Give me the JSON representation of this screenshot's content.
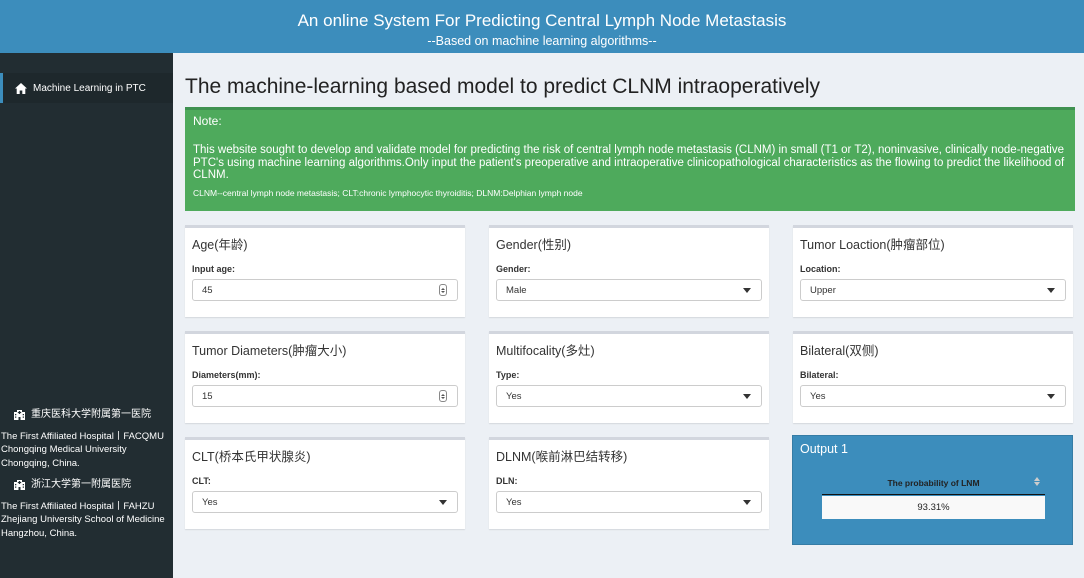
{
  "header": {
    "title": "An online System For Predicting Central Lymph Node Metastasis",
    "subtitle": "--Based on machine learning algorithms--"
  },
  "sidebar": {
    "menu_item": {
      "label": "Machine Learning in PTC",
      "icon": "home-icon"
    },
    "hospitals": [
      {
        "cn_name": "重庆医科大学附属第一医院",
        "icon": "hospital-icon",
        "lines": [
          "The First Affiliated Hospital丨FACQMU",
          "Chongqing Medical University",
          "Chongqing, China."
        ]
      },
      {
        "cn_name": "浙江大学第一附属医院",
        "icon": "hospital-icon",
        "lines": [
          "The First Affiliated Hospital丨FAHZU",
          "Zhejiang University School of Medicine",
          "Hangzhou, China."
        ]
      }
    ]
  },
  "main": {
    "title": "The machine-learning based model to predict CLNM intraoperatively",
    "note": {
      "heading": "Note:",
      "body": "This website sought to develop and validate model for predicting the risk of central lymph node metastasis (CLNM) in small (T1 or T2), noninvasive, clinically node-negative PTC's using machine learning algorithms.Only input the patient's preoperative and intraoperative clinicopathological characteristics as the flowing to predict the likelihood of CLNM.",
      "abbreviations": "CLNM--central lymph node metastasis; CLT:chronic lymphocytic thyroiditis; DLNM:Delphian lymph node"
    },
    "boxes": [
      {
        "title": "Age(年龄)",
        "label": "Input age:",
        "value": "45",
        "kind": "numeric"
      },
      {
        "title": "Gender(性别)",
        "label": "Gender:",
        "value": "Male",
        "kind": "select"
      },
      {
        "title": "Tumor Loaction(肿瘤部位)",
        "label": "Location:",
        "value": "Upper",
        "kind": "select"
      },
      {
        "title": "Tumor Diameters(肿瘤大小)",
        "label": "Diameters(mm):",
        "value": "15",
        "kind": "numeric"
      },
      {
        "title": "Multifocality(多灶)",
        "label": "Type:",
        "value": "Yes",
        "kind": "select"
      },
      {
        "title": "Bilateral(双侧)",
        "label": "Bilateral:",
        "value": "Yes",
        "kind": "select"
      },
      {
        "title": "CLT(桥本氏甲状腺炎)",
        "label": "CLT:",
        "value": "Yes",
        "kind": "select"
      },
      {
        "title": "DLNM(喉前淋巴结转移)",
        "label": "DLN:",
        "value": "Yes",
        "kind": "select"
      }
    ],
    "output": {
      "title": "Output 1",
      "column_header": "The probability of LNM",
      "value": "93.31%"
    }
  },
  "colors": {
    "header_bg": "#3c8dbc",
    "sidebar_bg": "#222d32",
    "note_bg": "#4eaa5c",
    "output_bg": "#3c8dbc"
  }
}
